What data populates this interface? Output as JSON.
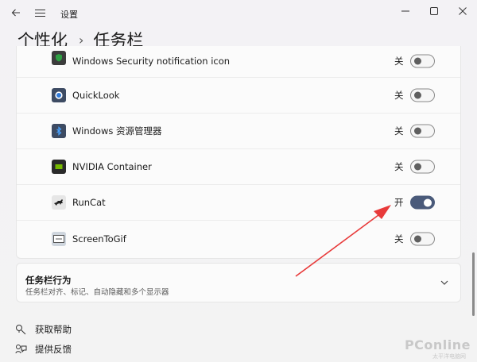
{
  "window": {
    "app_title": "设置",
    "breadcrumb": {
      "parent": "个性化",
      "separator": "›",
      "current": "任务栏"
    }
  },
  "icons": {
    "back": "back-arrow-icon",
    "menu": "hamburger-menu-icon",
    "minimize": "minimize-icon",
    "maximize": "maximize-icon",
    "close": "close-icon"
  },
  "tray_items": [
    {
      "label": "Windows Security notification icon",
      "state": "关",
      "on": false,
      "icon": "windows-security-icon"
    },
    {
      "label": "QuickLook",
      "state": "关",
      "on": false,
      "icon": "quicklook-icon"
    },
    {
      "label": "Windows 资源管理器",
      "state": "关",
      "on": false,
      "icon": "bluetooth-icon"
    },
    {
      "label": "NVIDIA Container",
      "state": "关",
      "on": false,
      "icon": "nvidia-icon"
    },
    {
      "label": "RunCat",
      "state": "开",
      "on": true,
      "icon": "runcat-icon"
    },
    {
      "label": "ScreenToGif",
      "state": "关",
      "on": false,
      "icon": "screentogif-icon"
    }
  ],
  "taskbar_behavior": {
    "title": "任务栏行为",
    "subtitle": "任务栏对齐、标记、自动隐藏和多个显示器"
  },
  "footer": {
    "help": "获取帮助",
    "feedback": "提供反馈"
  },
  "watermark": {
    "brand": "PConline",
    "tagline": "太平洋电脑网"
  },
  "colors": {
    "toggle_on": "#4a5a7a",
    "annotation_arrow": "#e83a3a"
  }
}
